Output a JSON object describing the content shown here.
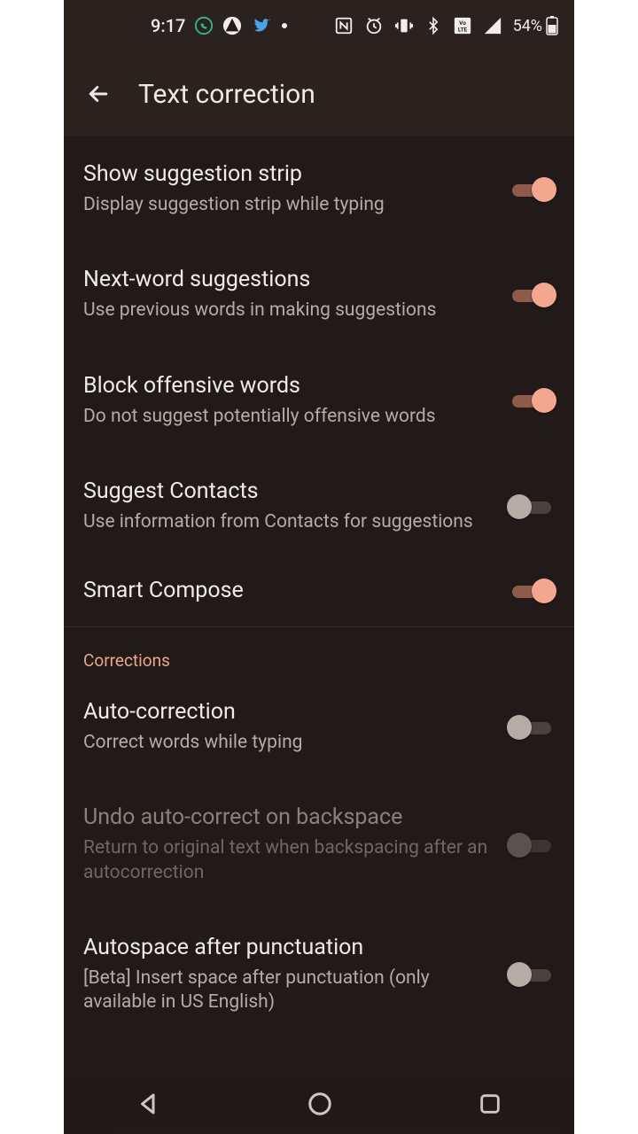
{
  "status": {
    "time": "9:17",
    "battery_pct": "54%"
  },
  "header": {
    "title": "Text correction"
  },
  "suggestions": [
    {
      "title": "Show suggestion strip",
      "desc": "Display suggestion strip while typing",
      "on": true
    },
    {
      "title": "Next-word suggestions",
      "desc": "Use previous words in making suggestions",
      "on": true
    },
    {
      "title": "Block offensive words",
      "desc": "Do not suggest potentially offensive words",
      "on": true
    },
    {
      "title": "Suggest Contacts",
      "desc": "Use information from Contacts for suggestions",
      "on": false
    },
    {
      "title": "Smart Compose",
      "desc": "",
      "on": true
    }
  ],
  "corrections_label": "Corrections",
  "corrections": [
    {
      "title": "Auto-correction",
      "desc": "Correct words while typing",
      "on": false,
      "disabled": false
    },
    {
      "title": "Undo auto-correct on backspace",
      "desc": "Return to original text when backspacing after an autocorrection",
      "on": false,
      "disabled": true
    },
    {
      "title": "Autospace after punctuation",
      "desc": "[Beta] Insert space after punctuation (only available in US English)",
      "on": false,
      "disabled": false
    }
  ]
}
